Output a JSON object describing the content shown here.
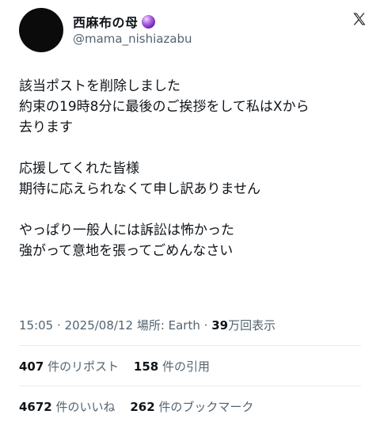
{
  "author": {
    "display_name": "西麻布の母",
    "handle": "@mama_nishiazabu",
    "badge_icon": "crystal-ball-icon"
  },
  "tweet": {
    "lines_1": [
      "該当ポストを削除しました",
      "約束の19時8分に最後のご挨拶をして私はXから",
      "去ります"
    ],
    "lines_2": [
      "応援してくれた皆様",
      "期待に応えられなくて申し訳ありません"
    ],
    "lines_3": [
      "やっぱり一般人には訴訟は怖かった",
      "強がって意地を張ってごめんなさい"
    ]
  },
  "meta": {
    "time": "15:05",
    "date": "2025/08/12",
    "location": "場所: Earth",
    "views_count": "39",
    "views_label": "万回表示"
  },
  "stats": {
    "reposts_count": "407",
    "reposts_label": "件のリポスト",
    "quotes_count": "158",
    "quotes_label": "件の引用",
    "likes_count": "4672",
    "likes_label": "件のいいね",
    "bookmarks_count": "262",
    "bookmarks_label": "件のブックマーク"
  },
  "colors": {
    "text": "#0f1419",
    "secondary": "#536471",
    "divider": "#e6ecf0"
  }
}
